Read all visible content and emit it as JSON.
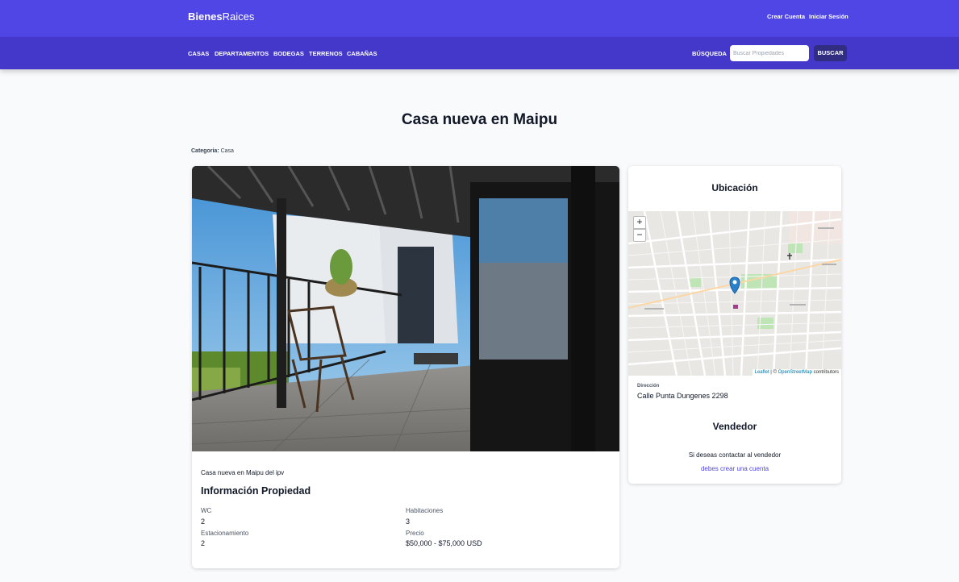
{
  "header": {
    "brand_bold": "Bienes",
    "brand_light": "Raices",
    "create_account": "Crear Cuenta",
    "login": "Iniciar Sesión"
  },
  "nav": {
    "items": [
      "CASAS",
      "DEPARTAMENTOS",
      "BODEGAS",
      "TERRENOS",
      "CABAÑAS"
    ],
    "search_label": "BÚSQUEDA",
    "search_placeholder": "Buscar Propiedades",
    "search_button": "BUSCAR"
  },
  "property": {
    "title": "Casa nueva en Maipu",
    "category_label": "Categoria:",
    "category_value": "Casa",
    "description": "Casa nueva en Maipu del ipv",
    "info_title": "Información Propiedad",
    "features": [
      {
        "label": "WC",
        "value": "2"
      },
      {
        "label": "Habitaciones",
        "value": "3"
      },
      {
        "label": "Estacionamiento",
        "value": "2"
      },
      {
        "label": "Precio",
        "value": "$50,000 - $75,000 USD"
      }
    ]
  },
  "location": {
    "title": "Ubicación",
    "zoom_in": "+",
    "zoom_out": "−",
    "attribution_leaflet": "Leaflet",
    "attribution_sep": " | © ",
    "attribution_osm": "OpenStreetMap",
    "attribution_tail": " contributors",
    "address_label": "Dirección",
    "address_value": "Calle Punta Dungenes 2298"
  },
  "seller": {
    "title": "Vendedor",
    "contact_text": "Si deseas contactar al vendedor",
    "contact_link": "debes crear una cuenta"
  },
  "colors": {
    "primary": "#4f46e5",
    "primary_dark": "#4338ca",
    "button_dark": "#312e81",
    "background": "#f9fafb"
  }
}
